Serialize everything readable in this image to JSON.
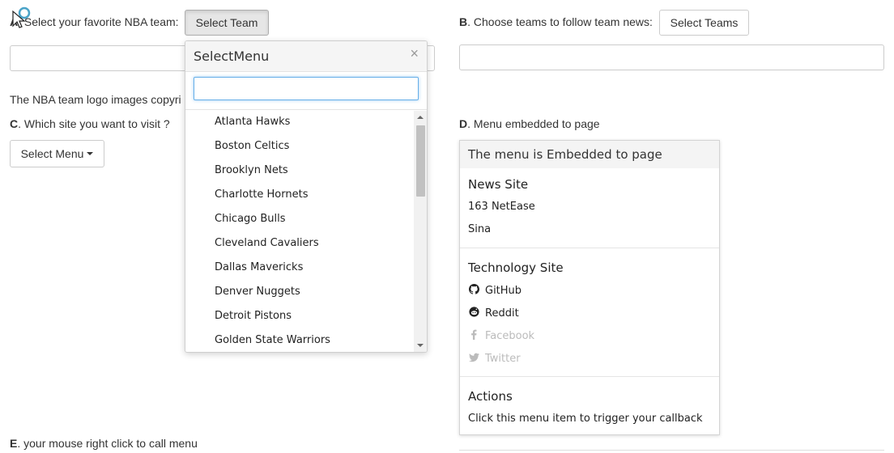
{
  "sectionA": {
    "letter": "A",
    "text": ". Select your favorite NBA team:",
    "button": "Select Team"
  },
  "sectionB": {
    "letter": "B",
    "text": ". Choose teams to follow team news:",
    "button": "Select Teams"
  },
  "copyright_text": "The NBA team logo images copyri",
  "sectionC": {
    "letter": "C",
    "text": ". Which site you want to visit ?",
    "button": "Select Menu"
  },
  "sectionD": {
    "letter": "D",
    "text": ". Menu embedded to page"
  },
  "sectionE": {
    "letter": "E",
    "text": ". your mouse right click to call menu"
  },
  "popup": {
    "title": "SelectMenu",
    "close": "×",
    "search_value": "",
    "items": [
      "Atlanta Hawks",
      "Boston Celtics",
      "Brooklyn Nets",
      "Charlotte Hornets",
      "Chicago Bulls",
      "Cleveland Cavaliers",
      "Dallas Mavericks",
      "Denver Nuggets",
      "Detroit Pistons",
      "Golden State Warriors"
    ]
  },
  "embedded_menu": {
    "title": "The menu is Embedded to page",
    "groups": [
      {
        "name": "News Site",
        "items": [
          {
            "label": "163 NetEase",
            "icon": "",
            "disabled": false
          },
          {
            "label": "Sina",
            "icon": "",
            "disabled": false
          }
        ]
      },
      {
        "name": "Technology Site",
        "items": [
          {
            "label": "GitHub",
            "icon": "github-icon",
            "disabled": false
          },
          {
            "label": "Reddit",
            "icon": "reddit-icon",
            "disabled": false
          },
          {
            "label": "Facebook",
            "icon": "facebook-icon",
            "disabled": true
          },
          {
            "label": "Twitter",
            "icon": "twitter-icon",
            "disabled": true
          }
        ]
      },
      {
        "name": "Actions",
        "items": [
          {
            "label": "Click this menu item to trigger your callback",
            "icon": "",
            "disabled": false
          }
        ]
      }
    ]
  },
  "colors": {
    "focus_border": "#66afe9",
    "disabled_text": "#bbbbbb",
    "header_bg": "#f5f5f5"
  }
}
